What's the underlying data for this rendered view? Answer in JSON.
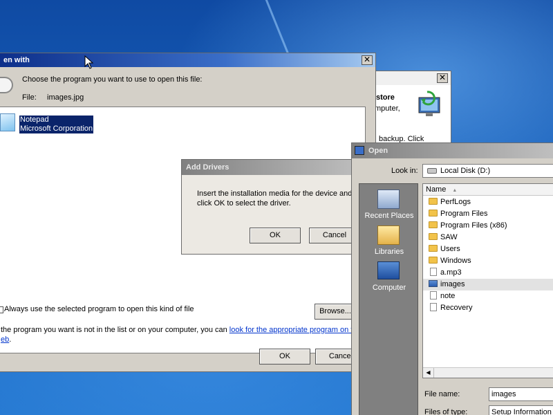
{
  "colors": {
    "desktop": "#1c5fb1",
    "selection": "#0a246a",
    "titlebar_active": "#0d2f8a"
  },
  "open_with": {
    "title": "en with",
    "prompt": "Choose the program you want to use to open this file:",
    "file_label": "File:",
    "file_name": "images.jpg",
    "programs": [
      {
        "name": "Notepad",
        "publisher": "Microsoft Corporation",
        "icon": "notepad-icon",
        "selected": true
      }
    ],
    "always_use_label": "Always use the selected program to open this kind of file",
    "browse_label": "Browse...",
    "help_text_prefix": "the program you want is not in the list or on your computer, you can ",
    "help_link": "look for the appropriate program on t",
    "help_link_tail": "eb",
    "help_text_end": ".",
    "ok_label": "OK",
    "cancel_label": "Cancel"
  },
  "backup_window": {
    "heading": "store",
    "line1": "mputer,",
    "line2": "backup. Click",
    "icon": "computer-restore-icon"
  },
  "add_drivers": {
    "title": "Add Drivers",
    "line1": "Insert the installation media for the device and",
    "line2": "click OK to select the driver.",
    "ok_label": "OK",
    "cancel_label": "Cancel"
  },
  "open_dialog": {
    "title": "Open",
    "look_in_label": "Look in:",
    "look_in_value": "Local Disk (D:)",
    "places": [
      {
        "label": "Recent Places",
        "icon": "recent-places-icon"
      },
      {
        "label": "Libraries",
        "icon": "libraries-icon"
      },
      {
        "label": "Computer",
        "icon": "computer-icon"
      }
    ],
    "column_name": "Name",
    "items": [
      {
        "name": "PerfLogs",
        "type": "folder"
      },
      {
        "name": "Program Files",
        "type": "folder"
      },
      {
        "name": "Program Files (x86)",
        "type": "folder"
      },
      {
        "name": "SAW",
        "type": "folder"
      },
      {
        "name": "Users",
        "type": "folder"
      },
      {
        "name": "Windows",
        "type": "folder"
      },
      {
        "name": "a.mp3",
        "type": "file"
      },
      {
        "name": "images",
        "type": "image",
        "selected": true
      },
      {
        "name": "note",
        "type": "file"
      },
      {
        "name": "Recovery",
        "type": "file"
      }
    ],
    "file_name_label": "File name:",
    "file_name_value": "images",
    "files_of_type_label": "Files of type:",
    "files_of_type_value": "Setup Information"
  }
}
